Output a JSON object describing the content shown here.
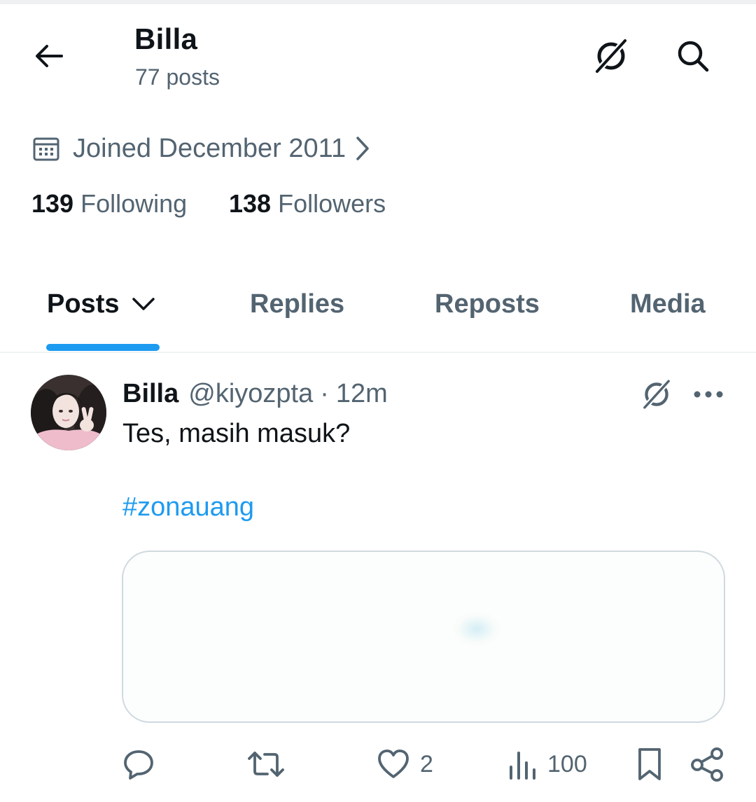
{
  "header": {
    "title": "Billa",
    "post_count": "77 posts",
    "icons": {
      "back": "arrow-left-icon",
      "grok": "grok-icon",
      "search": "search-icon"
    }
  },
  "profile": {
    "joined": "Joined December 2011",
    "following": {
      "count": "139",
      "label": "Following"
    },
    "followers": {
      "count": "138",
      "label": "Followers"
    }
  },
  "tabs": [
    {
      "label": "Posts",
      "active": true
    },
    {
      "label": "Replies",
      "active": false
    },
    {
      "label": "Reposts",
      "active": false
    },
    {
      "label": "Media",
      "active": false
    }
  ],
  "post": {
    "name": "Billa",
    "handle": "@kiyozpta",
    "separator": "·",
    "time": "12m",
    "text": "Tes, masih masuk?",
    "hashtag": "#zonauang",
    "actions": {
      "replies": "",
      "reposts": "",
      "likes": "2",
      "views": "100"
    }
  },
  "colors": {
    "accent": "#1d9bf0",
    "text_primary": "#0f1419",
    "text_secondary": "#536471",
    "border": "#cfd9de"
  }
}
